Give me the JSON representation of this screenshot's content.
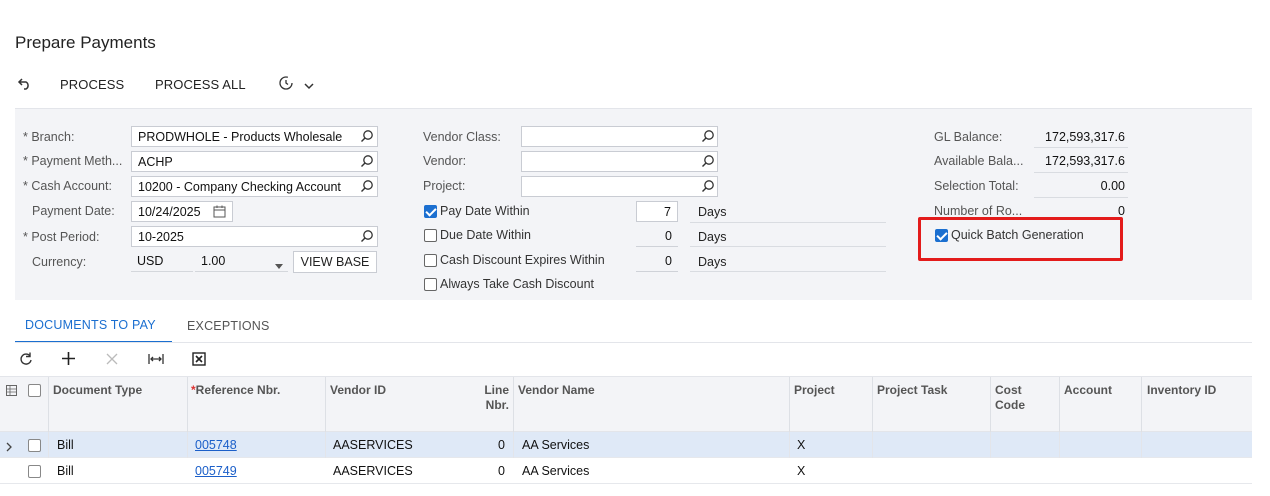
{
  "page": {
    "title": "Prepare Payments"
  },
  "toolbar": {
    "process_label": "PROCESS",
    "process_all_label": "PROCESS ALL"
  },
  "form": {
    "branch": {
      "label": "Branch:",
      "value": "PRODWHOLE - Products Wholesale"
    },
    "payment_method": {
      "label": "Payment Meth...",
      "value": "ACHP"
    },
    "cash_account": {
      "label": "Cash Account:",
      "value": "10200 - Company Checking Account"
    },
    "payment_date": {
      "label": "Payment Date:",
      "value": "10/24/2025"
    },
    "post_period": {
      "label": "Post Period:",
      "value": "10-2025"
    },
    "currency": {
      "label": "Currency:",
      "value": "USD",
      "rate": "1.00",
      "view_base_label": "VIEW BASE"
    },
    "vendor_class": {
      "label": "Vendor Class:",
      "value": ""
    },
    "vendor": {
      "label": "Vendor:",
      "value": ""
    },
    "project": {
      "label": "Project:",
      "value": ""
    },
    "pay_date_within": {
      "label": "Pay Date Within",
      "checked": true,
      "value": "7",
      "unit": "Days"
    },
    "due_date_within": {
      "label": "Due Date Within",
      "checked": false,
      "value": "0",
      "unit": "Days"
    },
    "cash_discount_expires": {
      "label": "Cash Discount Expires Within",
      "checked": false,
      "value": "0",
      "unit": "Days"
    },
    "always_take_discount": {
      "label": "Always Take Cash Discount",
      "checked": false
    },
    "gl_balance": {
      "label": "GL Balance:",
      "value": "172,593,317.6"
    },
    "available_balance": {
      "label": "Available Bala...",
      "value": "172,593,317.6"
    },
    "selection_total": {
      "label": "Selection Total:",
      "value": "0.00"
    },
    "number_of_rows": {
      "label": "Number of Ro...",
      "value": "0"
    },
    "quick_batch": {
      "label": "Quick Batch Generation",
      "checked": true
    }
  },
  "tabs": [
    {
      "label": "DOCUMENTS TO PAY",
      "active": true
    },
    {
      "label": "EXCEPTIONS",
      "active": false
    }
  ],
  "grid": {
    "columns": {
      "document_type": "Document Type",
      "reference_nbr": "Reference Nbr.",
      "vendor_id": "Vendor ID",
      "line_nbr_1": "Line",
      "line_nbr_2": "Nbr.",
      "vendor_name": "Vendor Name",
      "project": "Project",
      "project_task": "Project Task",
      "cost_code_1": "Cost",
      "cost_code_2": "Code",
      "account": "Account",
      "inventory_id": "Inventory ID"
    },
    "rows": [
      {
        "document_type": "Bill",
        "reference_nbr": "005748",
        "vendor_id": "AASERVICES",
        "line_nbr": "0",
        "vendor_name": "AA Services",
        "project": "X"
      },
      {
        "document_type": "Bill",
        "reference_nbr": "005749",
        "vendor_id": "AASERVICES",
        "line_nbr": "0",
        "vendor_name": "AA Services",
        "project": "X"
      }
    ]
  },
  "colors": {
    "accent": "#1b6fd0",
    "highlight": "#e31b1b",
    "panel_bg": "#f3f4f7",
    "selected_row": "#dfe9f7"
  }
}
